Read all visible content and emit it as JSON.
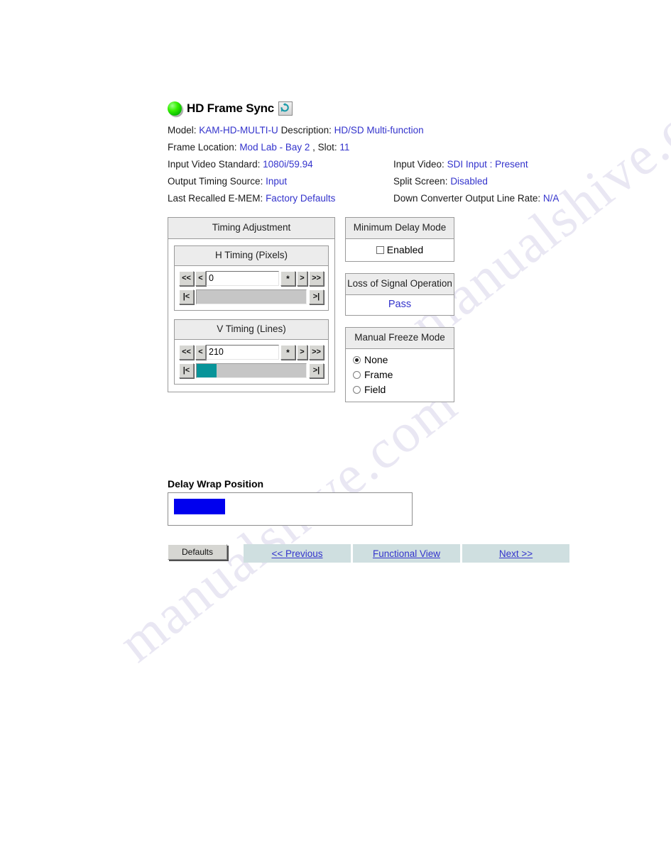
{
  "header": {
    "status_led": "green-led-icon",
    "title": "HD Frame Sync",
    "refresh_icon": "refresh-icon",
    "model_label": "Model:",
    "model_value": "KAM-HD-MULTI-U",
    "description_label": "Description:",
    "description_value": "HD/SD Multi-function",
    "frame_location_label": "Frame Location:",
    "frame_location_value": "Mod Lab - Bay 2",
    "slot_label": ", Slot:",
    "slot_value": "11",
    "input_video_standard_label": "Input Video Standard:",
    "input_video_standard_value": "1080i/59.94",
    "input_video_label": "Input Video:",
    "input_video_value": "SDI Input : Present",
    "output_timing_source_label": "Output Timing Source:",
    "output_timing_source_value": "Input",
    "split_screen_label": "Split Screen:",
    "split_screen_value": "Disabled",
    "last_recalled_emem_label": "Last Recalled E-MEM:",
    "last_recalled_emem_value": "Factory Defaults",
    "down_converter_label": "Down Converter Output Line Rate:",
    "down_converter_value": "N/A"
  },
  "timing_adjustment": {
    "title": "Timing Adjustment",
    "h_timing": {
      "title": "H Timing (Pixels)",
      "value": "0",
      "slider_percent": 0,
      "buttons": {
        "fast_back": "<<",
        "back": "<",
        "reset": "*",
        "forward": ">",
        "fast_forward": ">>",
        "min": "|<",
        "max": ">|"
      }
    },
    "v_timing": {
      "title": "V Timing (Lines)",
      "value": "210",
      "slider_percent": 18,
      "buttons": {
        "fast_back": "<<",
        "back": "<",
        "reset": "*",
        "forward": ">",
        "fast_forward": ">>",
        "min": "|<",
        "max": ">|"
      }
    }
  },
  "minimum_delay_mode": {
    "title": "Minimum Delay Mode",
    "checkbox_label": "Enabled",
    "checked": false
  },
  "loss_of_signal": {
    "title": "Loss of Signal Operation",
    "value": "Pass"
  },
  "manual_freeze_mode": {
    "title": "Manual Freeze Mode",
    "options": [
      "None",
      "Frame",
      "Field"
    ],
    "selected": "None"
  },
  "delay_wrap_position": {
    "label": "Delay Wrap Position",
    "bar_percent": 22
  },
  "footer": {
    "defaults_label": "Defaults",
    "nav": [
      {
        "label": "<< Previous",
        "name": "previous"
      },
      {
        "label": "Functional View",
        "name": "functional-view"
      },
      {
        "label": "Next >>",
        "name": "next"
      }
    ]
  },
  "colors": {
    "link": "#3333cc",
    "slider_thumb": "#089499",
    "delay_bar": "#0000ee",
    "nav_bg": "#cfdfe0",
    "panel_header": "#ececec",
    "led_green": "#35f000"
  },
  "watermark": {
    "line1": "manualshive.com",
    "line2": "manualshive.com"
  }
}
